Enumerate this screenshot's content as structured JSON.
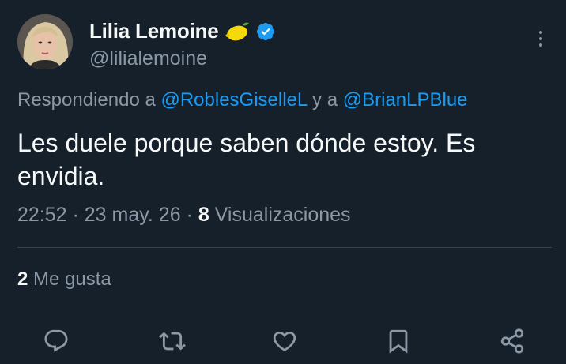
{
  "author": {
    "display_name": "Lilia Lemoine",
    "handle": "@lilialemoine",
    "name_emoji": "lemon-icon",
    "verified": true
  },
  "reply_context": {
    "prefix": "Respondiendo a ",
    "mention_1": "@RoblesGiselleL",
    "connector": " y a ",
    "mention_2": "@BrianLPBlue"
  },
  "tweet": {
    "text": "Les duele porque saben dónde estoy. Es envidia."
  },
  "meta": {
    "time": "22:52",
    "sep1": " · ",
    "date": "23 may. 26",
    "sep2": " · ",
    "views_count": "8",
    "views_label": " Visualizaciones"
  },
  "stats": {
    "likes_count": "2",
    "likes_label": " Me gusta"
  },
  "actions": [
    "reply-icon",
    "retweet-icon",
    "like-icon",
    "bookmark-icon",
    "share-icon"
  ],
  "colors": {
    "background": "#15202b",
    "text_primary": "#f7f9f9",
    "text_secondary": "#8b98a5",
    "accent": "#1d9bf0",
    "divider": "#38444d"
  }
}
